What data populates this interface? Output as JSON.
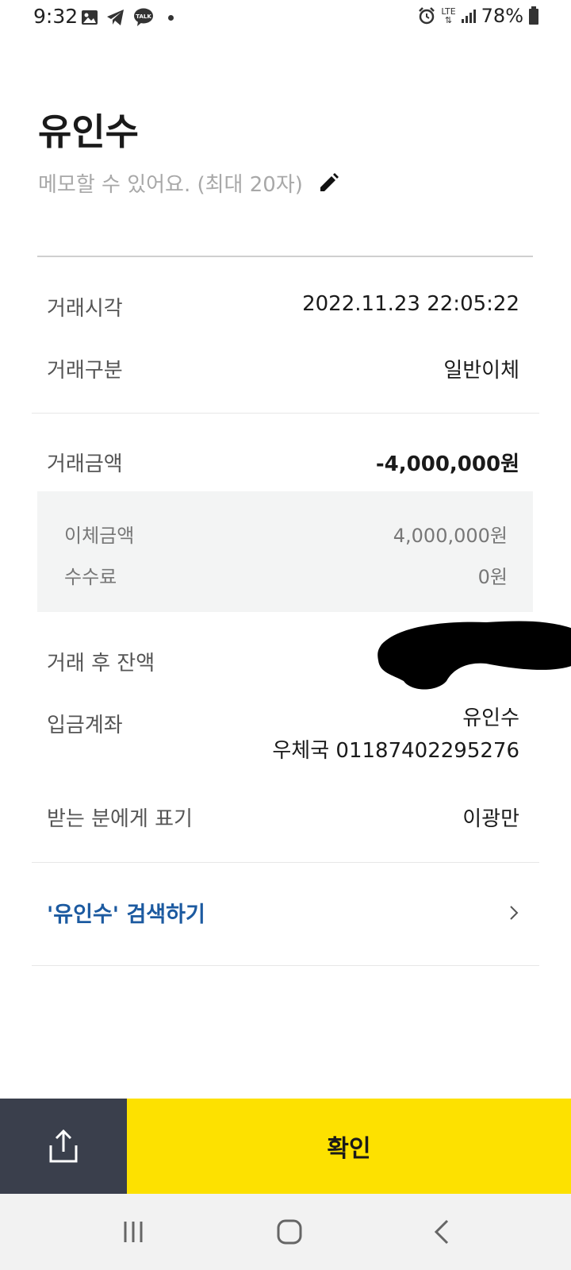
{
  "status_bar": {
    "time": "9:32",
    "network": "LTE",
    "battery": "78%"
  },
  "header": {
    "title": "유인수",
    "memo_placeholder": "메모할 수 있어요. (최대 20자)"
  },
  "details": {
    "time_label": "거래시각",
    "time_value": "2022.11.23 22:05:22",
    "type_label": "거래구분",
    "type_value": "일반이체",
    "amount_label": "거래금액",
    "amount_value": "-4,000,000원",
    "transfer_label": "이체금액",
    "transfer_value": "4,000,000원",
    "fee_label": "수수료",
    "fee_value": "0원",
    "balance_label": "거래 후 잔액",
    "account_label": "입금계좌",
    "account_name": "유인수",
    "account_number": "우체국 01187402295276",
    "display_label": "받는 분에게 표기",
    "display_value": "이광만"
  },
  "search": {
    "label": "'유인수' 검색하기"
  },
  "actions": {
    "confirm_label": "확인"
  },
  "colors": {
    "accent_yellow": "#fde100",
    "share_bg": "#3a3f4c",
    "link_blue": "#1c5aa0"
  }
}
